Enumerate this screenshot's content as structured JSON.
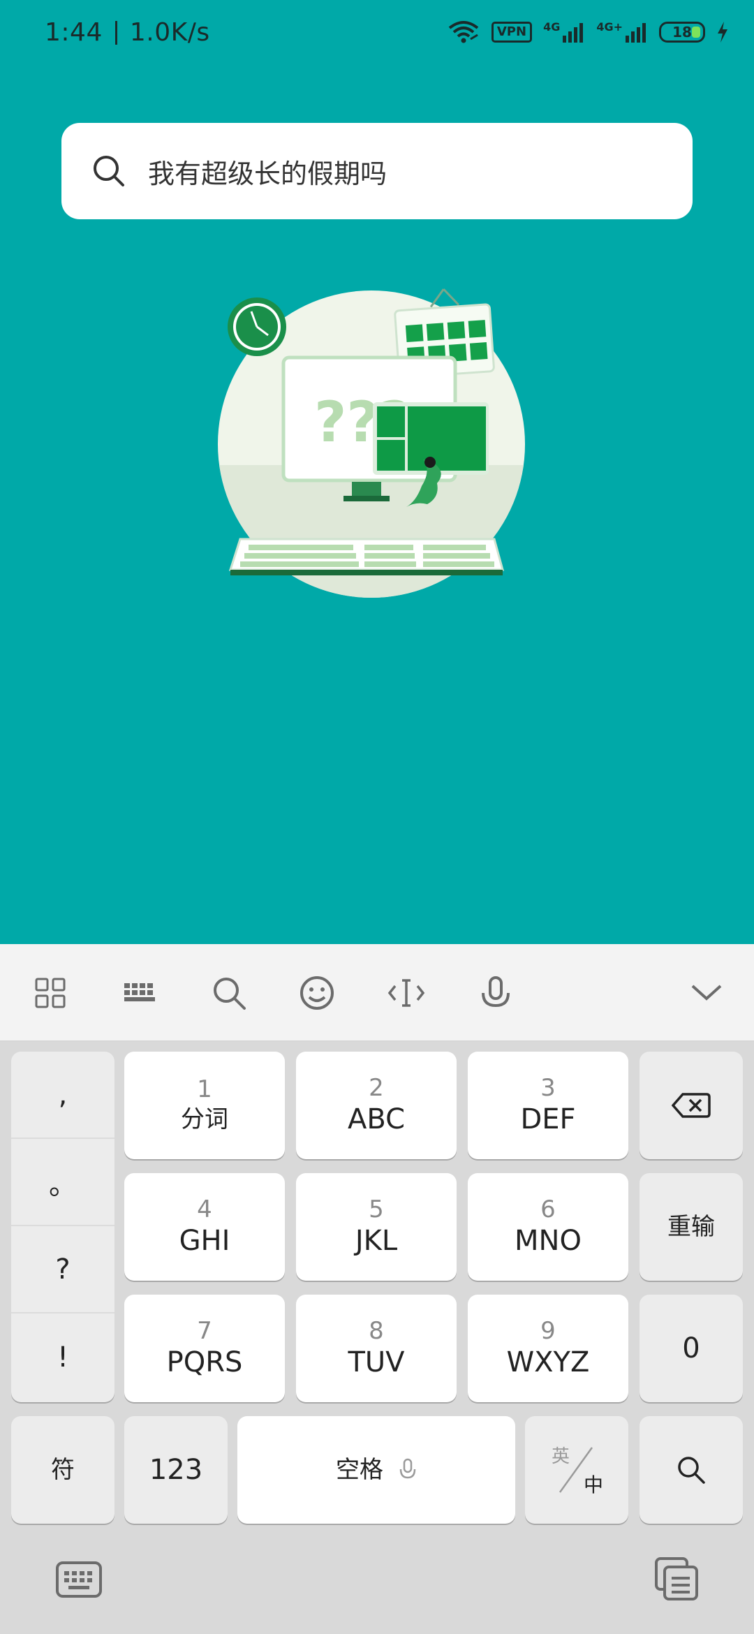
{
  "status": {
    "time": "1:44",
    "speed": "1.0K/s",
    "vpn": "VPN",
    "net1": "4G",
    "net2": "4G+",
    "battery": "18"
  },
  "search": {
    "text": "我有超级长的假期吗"
  },
  "illustration": {
    "marks": "???"
  },
  "toolbar": {
    "icons": [
      "grid-icon",
      "keyboard-icon",
      "search-icon",
      "emoji-icon",
      "cursor-icon",
      "microphone-icon",
      "chevron-down-icon"
    ]
  },
  "keyboard": {
    "punctuation": [
      ",",
      "。",
      "?",
      "!"
    ],
    "keys": [
      {
        "num": "1",
        "label": "分词"
      },
      {
        "num": "2",
        "label": "ABC"
      },
      {
        "num": "3",
        "label": "DEF"
      },
      {
        "num": "4",
        "label": "GHI"
      },
      {
        "num": "5",
        "label": "JKL"
      },
      {
        "num": "6",
        "label": "MNO"
      },
      {
        "num": "7",
        "label": "PQRS"
      },
      {
        "num": "8",
        "label": "TUV"
      },
      {
        "num": "9",
        "label": "WXYZ"
      }
    ],
    "retype": "重输",
    "zero": "0",
    "symbol": "符",
    "numeric": "123",
    "space": "空格",
    "lang_top": "英",
    "lang_bottom": "中"
  }
}
